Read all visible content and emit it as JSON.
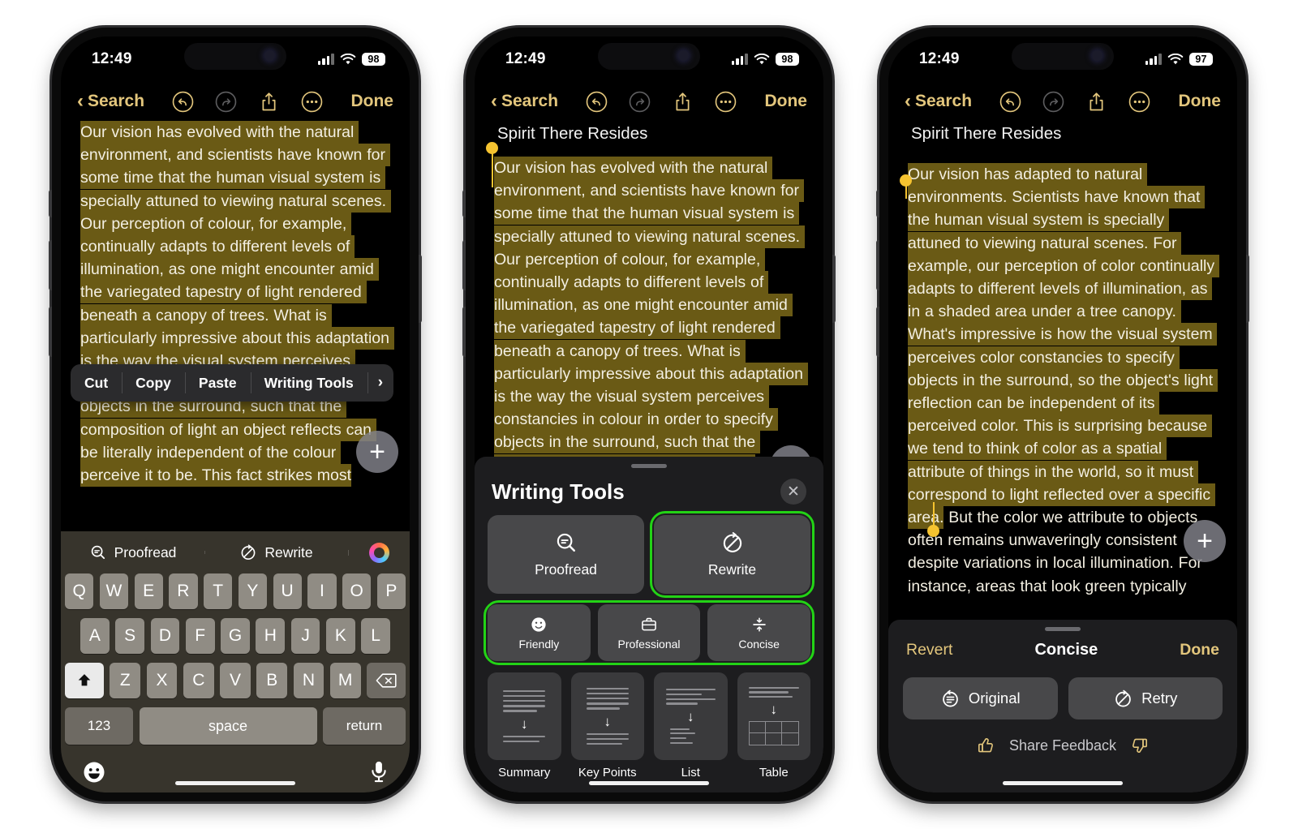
{
  "statusbar": {
    "time": "12:49",
    "battery_1": "98",
    "battery_2": "98",
    "battery_3": "97"
  },
  "navbar": {
    "back_label": "Search",
    "done_label": "Done",
    "icons": [
      "undo-icon",
      "redo-icon",
      "share-icon",
      "more-icon"
    ]
  },
  "phone1": {
    "body_text": "Our vision has evolved with the natural environment, and scientists have known for some time that the human visual system is specially attuned to viewing natural scenes. Our perception of colour, for example, continually adapts to different levels of illumination, as one might encounter amid the variegated tapestry of light rendered beneath a canopy of trees. What is particularly impressive about this adaptation is the way the visual system perceives constancies in colour in order to specify objects in the surround, such that the composition of light an object reflects can be literally independent of the colour perceive it to be. This fact strikes most",
    "context_menu": {
      "cut": "Cut",
      "copy": "Copy",
      "paste": "Paste",
      "writing_tools": "Writing Tools",
      "more_arrow": "›"
    },
    "keyboard": {
      "suggest_proofread": "Proofread",
      "suggest_rewrite": "Rewrite",
      "ai_icon": "apple-intelligence-icon",
      "row1": [
        "Q",
        "W",
        "E",
        "R",
        "T",
        "Y",
        "U",
        "I",
        "O",
        "P"
      ],
      "row2": [
        "A",
        "S",
        "D",
        "F",
        "G",
        "H",
        "J",
        "K",
        "L"
      ],
      "row3": [
        "Z",
        "X",
        "C",
        "V",
        "B",
        "N",
        "M"
      ],
      "shift": "shift-icon",
      "delete": "delete-icon",
      "numbers": "123",
      "space": "space",
      "return": "return",
      "emoji": "emoji-icon",
      "mic": "microphone-icon"
    },
    "fab": "+"
  },
  "phone2": {
    "note_title": "Spirit There Resides",
    "body_text": "Our vision has evolved with the natural environment, and scientists have known for some time that the human visual system is specially attuned to viewing natural scenes. Our perception of colour, for example, continually adapts to different levels of illumination, as one might encounter amid the variegated tapestry of light rendered beneath a canopy of trees. What is particularly impressive about this adaptation is the way the visual system perceives constancies in colour in order to specify objects in the surround, such that the composition of light an object reflects",
    "sheet": {
      "title": "Writing Tools",
      "close": "✕",
      "proofread": "Proofread",
      "rewrite": "Rewrite",
      "tones": [
        {
          "label": "Friendly",
          "icon": "smiley-icon"
        },
        {
          "label": "Professional",
          "icon": "briefcase-icon"
        },
        {
          "label": "Concise",
          "icon": "compress-icon"
        }
      ],
      "cards": [
        {
          "label": "Summary",
          "icon": "summary-icon"
        },
        {
          "label": "Key Points",
          "icon": "key-points-icon"
        },
        {
          "label": "List",
          "icon": "list-icon"
        },
        {
          "label": "Table",
          "icon": "table-icon"
        }
      ]
    },
    "fab": "+"
  },
  "phone3": {
    "note_title": "Spirit There Resides",
    "body_highlighted": "Our vision has adapted to natural environments. Scientists have known that the human visual system is specially attuned to viewing natural scenes. For example, our perception of color continually adapts to different levels of illumination, as in a shaded area under a tree canopy. What's impressive is how the visual system perceives color constancies to specify objects in the surround, so the object's light reflection can be independent of its perceived color. This is surprising because we tend to think of color as a spatial attribute of things in the world, so it must correspond to light reflected over a specific area.",
    "body_rest": " But the color we attribute to objects often remains unwaveringly consistent despite variations in local illumination. For instance, areas that look green typically",
    "result_bar": {
      "revert": "Revert",
      "title": "Concise",
      "done": "Done",
      "original": "Original",
      "retry": "Retry",
      "share_feedback": "Share Feedback",
      "thumbs_up": "thumbs-up-icon",
      "thumbs_down": "thumbs-down-icon"
    },
    "fab": "+"
  },
  "colors": {
    "highlight": "#6a5a15",
    "accent_gold": "#e3c67c",
    "selection_handle": "#f5c330",
    "green_outline": "#23d316",
    "sheet_bg": "#1d1d1f"
  }
}
